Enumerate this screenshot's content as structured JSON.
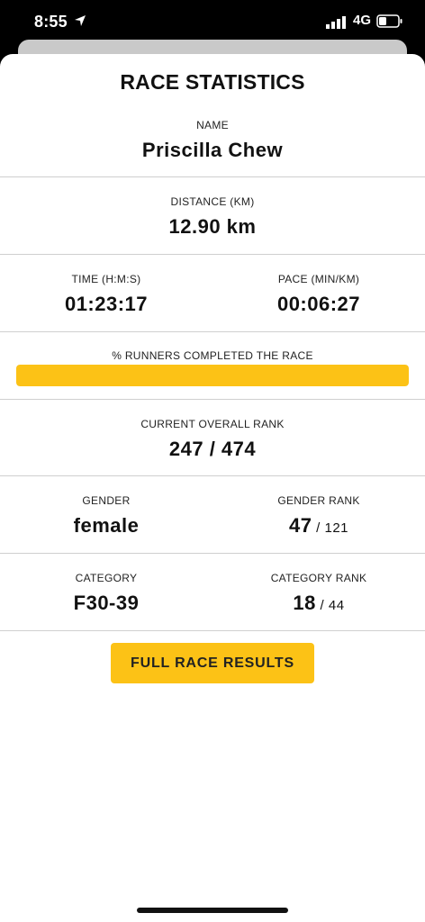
{
  "status_bar": {
    "time": "8:55",
    "network": "4G"
  },
  "title": "RACE STATISTICS",
  "name": {
    "label": "NAME",
    "value": "Priscilla Chew"
  },
  "distance": {
    "label": "DISTANCE (KM)",
    "value": "12.90 km"
  },
  "time": {
    "label": "TIME (H:M:S)",
    "value": "01:23:17"
  },
  "pace": {
    "label": "PACE (MIN/KM)",
    "value": "00:06:27"
  },
  "progress": {
    "label": "% RUNNERS COMPLETED THE RACE",
    "fraction": 1.0,
    "color": "#fcc216"
  },
  "overall_rank": {
    "label": "CURRENT OVERALL RANK",
    "value": "247 / 474"
  },
  "gender": {
    "label": "GENDER",
    "value": "female"
  },
  "gender_rank": {
    "label": "GENDER RANK",
    "rank": "47",
    "total": " / 121"
  },
  "category": {
    "label": "CATEGORY",
    "value": "F30-39"
  },
  "category_rank": {
    "label": "CATEGORY RANK",
    "rank": "18",
    "total": " / 44"
  },
  "cta": {
    "label": "FULL RACE RESULTS"
  },
  "colors": {
    "accent": "#fcc216",
    "status_bar_bg": "#000000",
    "sheet_bg": "#ffffff"
  },
  "icons": [
    "location-arrow-icon",
    "signal-icon",
    "battery-icon"
  ]
}
